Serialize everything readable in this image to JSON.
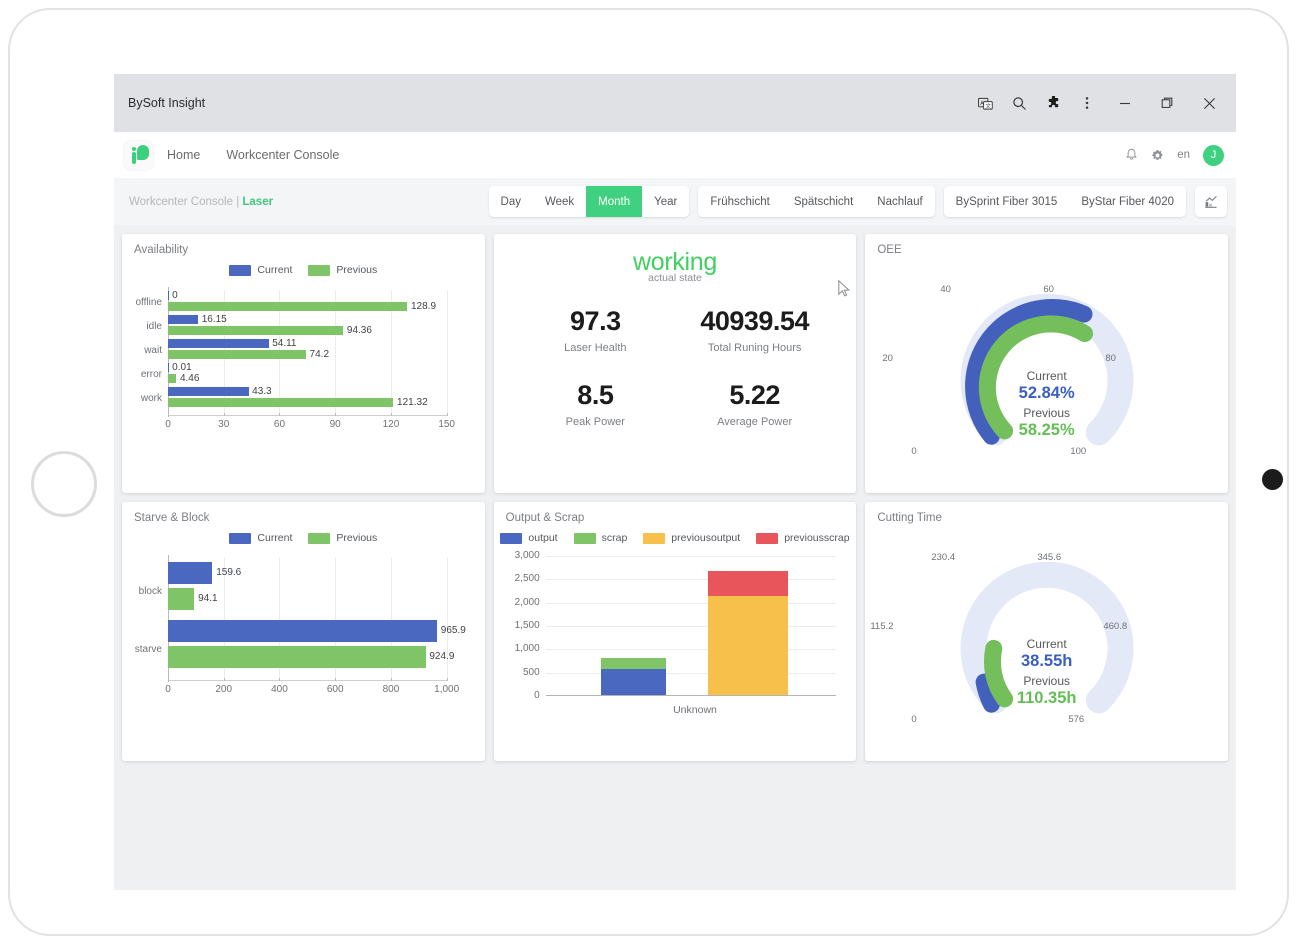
{
  "window": {
    "title": "BySoft Insight",
    "icons": [
      "translate-icon",
      "search-icon",
      "extensions-icon",
      "more-menu-icon"
    ],
    "controls": [
      "minimize",
      "restore",
      "close"
    ]
  },
  "appnav": {
    "logo_alt": "bysoft-logo",
    "links": [
      {
        "label": "Home"
      },
      {
        "label": "Workcenter Console"
      }
    ],
    "notifications_icon": "bell-icon",
    "settings_icon": "gear-icon",
    "language": "en",
    "avatar_initial": "J"
  },
  "filterbar": {
    "breadcrumb_prefix": "Workcenter Console",
    "breadcrumb_sep": "|",
    "breadcrumb_current": "Laser",
    "period_options": [
      {
        "label": "Day",
        "active": false
      },
      {
        "label": "Week",
        "active": false
      },
      {
        "label": "Month",
        "active": true
      },
      {
        "label": "Year",
        "active": false
      }
    ],
    "shift_options": [
      {
        "label": "Frühschicht"
      },
      {
        "label": "Spätschicht"
      },
      {
        "label": "Nachlauf"
      }
    ],
    "machine_options": [
      {
        "label": "BySprint Fiber 3015"
      },
      {
        "label": "ByStar Fiber 4020"
      }
    ],
    "chart_toggle_icon": "chart-icon"
  },
  "colors": {
    "current_blue": "#4a68c0",
    "previous_green": "#7fc466",
    "output_blue": "#4a68c0",
    "scrap_green": "#7fc466",
    "previousoutput_yellow": "#f7c04a",
    "previousscrap_red": "#e8565c",
    "gauge_track": "#e4e9f7",
    "accent_green": "#3fd17f",
    "state_green": "#3fd060"
  },
  "cards": {
    "availability": {
      "title": "Availability"
    },
    "state": {
      "title": ""
    },
    "oee": {
      "title": "OEE"
    },
    "starve_block": {
      "title": "Starve & Block"
    },
    "output_scrap": {
      "title": "Output & Scrap"
    },
    "cutting_time": {
      "title": "Cutting Time"
    }
  },
  "kpi": {
    "state_value": "working",
    "state_label": "actual state",
    "metrics": [
      {
        "value": "97.3",
        "label": "Laser Health"
      },
      {
        "value": "40939.54",
        "label": "Total Runing Hours"
      },
      {
        "value": "8.5",
        "label": "Peak Power"
      },
      {
        "value": "5.22",
        "label": "Average Power"
      }
    ]
  },
  "gauges": [
    {
      "key": "oee",
      "title": "OEE",
      "current_caption": "Current",
      "current_value": "52.84%",
      "previous_caption": "Previous",
      "previous_value": "58.25%",
      "current_number": 52.84,
      "previous_number": 58.25,
      "min": 0,
      "max": 100,
      "ticks": [
        "0",
        "20",
        "40",
        "60",
        "80",
        "100"
      ]
    },
    {
      "key": "cutting_time",
      "title": "Cutting Time",
      "current_caption": "Current",
      "current_value": "38.55h",
      "previous_caption": "Previous",
      "previous_value": "110.35h",
      "current_number": 38.55,
      "previous_number": 110.35,
      "min": 0,
      "max": 576,
      "ticks": [
        "0",
        "115.2",
        "230.4",
        "345.6",
        "460.8",
        "576"
      ]
    }
  ],
  "chart_data": [
    {
      "type": "bar",
      "key": "availability",
      "title": "Availability",
      "orientation": "horizontal",
      "categories": [
        "offline",
        "idle",
        "wait",
        "error",
        "work"
      ],
      "series": [
        {
          "name": "Current",
          "color": "#4a68c0",
          "values": [
            0,
            16.15,
            54.11,
            0.01,
            43.3
          ]
        },
        {
          "name": "Previous",
          "color": "#7fc466",
          "values": [
            128.9,
            94.36,
            74.2,
            4.46,
            121.32
          ]
        }
      ],
      "labels": {
        "Current": [
          "0",
          "16.15",
          "54.11",
          "0.01",
          "43.3"
        ],
        "Previous": [
          "128.9",
          "94.36",
          "74.2",
          "4.46",
          "121.32"
        ]
      },
      "xlabel": "",
      "ylabel": "",
      "xlim": [
        0,
        150
      ],
      "xticks": [
        "0",
        "30",
        "60",
        "90",
        "120",
        "150"
      ],
      "legend": [
        "Current",
        "Previous"
      ],
      "legend_position": "top-center",
      "grid": true
    },
    {
      "type": "bar",
      "key": "starve_block",
      "title": "Starve & Block",
      "orientation": "horizontal",
      "categories": [
        "block",
        "starve"
      ],
      "series": [
        {
          "name": "Current",
          "color": "#4a68c0",
          "values": [
            159.6,
            965.9
          ]
        },
        {
          "name": "Previous",
          "color": "#7fc466",
          "values": [
            94.1,
            924.9
          ]
        }
      ],
      "labels": {
        "Current": [
          "159.6",
          "965.9"
        ],
        "Previous": [
          "94.1",
          "924.9"
        ]
      },
      "xlabel": "",
      "ylabel": "",
      "xlim": [
        0,
        1000
      ],
      "xticks": [
        "0",
        "200",
        "400",
        "600",
        "800",
        "1,000"
      ],
      "legend": [
        "Current",
        "Previous"
      ],
      "legend_position": "top-center",
      "grid": true
    },
    {
      "type": "bar",
      "key": "output_scrap",
      "title": "Output & Scrap",
      "orientation": "vertical",
      "stacked": true,
      "categories": [
        "Unknown"
      ],
      "series": [
        {
          "name": "output",
          "color": "#4a68c0",
          "values": [
            560
          ],
          "stack": "current"
        },
        {
          "name": "scrap",
          "color": "#7fc466",
          "values": [
            240
          ],
          "stack": "current"
        },
        {
          "name": "previousoutput",
          "color": "#f7c04a",
          "values": [
            2120
          ],
          "stack": "previous"
        },
        {
          "name": "previousscrap",
          "color": "#e8565c",
          "values": [
            545
          ],
          "stack": "previous"
        }
      ],
      "xlabel": "",
      "ylabel": "",
      "ylim": [
        0,
        3000
      ],
      "yticks": [
        "0",
        "500",
        "1,000",
        "1,500",
        "2,000",
        "2,500",
        "3,000"
      ],
      "legend": [
        "output",
        "scrap",
        "previousoutput",
        "previousscrap"
      ],
      "legend_position": "top-center",
      "grid": true
    }
  ]
}
